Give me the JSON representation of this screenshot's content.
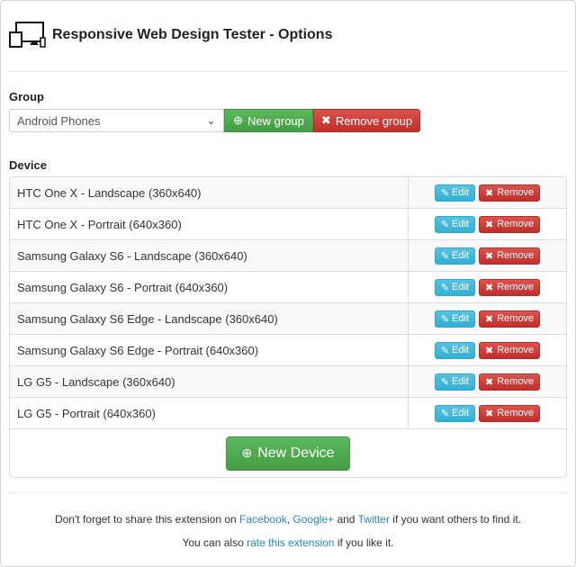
{
  "header": {
    "title": "Responsive Web Design Tester - Options",
    "icon": "devices-icon"
  },
  "group": {
    "label": "Group",
    "selected": "Android Phones",
    "new_label": "New group",
    "remove_label": "Remove group"
  },
  "device": {
    "label": "Device",
    "edit_label": "Edit",
    "remove_label": "Remove",
    "new_label": "New Device",
    "items": [
      "HTC One X - Landscape (360x640)",
      "HTC One X - Portrait (640x360)",
      "Samsung Galaxy S6 - Landscape (360x640)",
      "Samsung Galaxy S6 - Portrait (640x360)",
      "Samsung Galaxy S6 Edge - Landscape (360x640)",
      "Samsung Galaxy S6 Edge - Portrait (640x360)",
      "LG G5 - Landscape (360x640)",
      "LG G5 - Portrait (640x360)"
    ]
  },
  "footer": {
    "l1a": "Don't forget to share this extension on ",
    "facebook": "Facebook",
    "comma": ", ",
    "google": "Google+",
    "and": " and ",
    "twitter": "Twitter",
    "l1b": " if you want others to find it.",
    "l2a": "You can also ",
    "rate": "rate this extension",
    "l2b": " if you like it."
  }
}
